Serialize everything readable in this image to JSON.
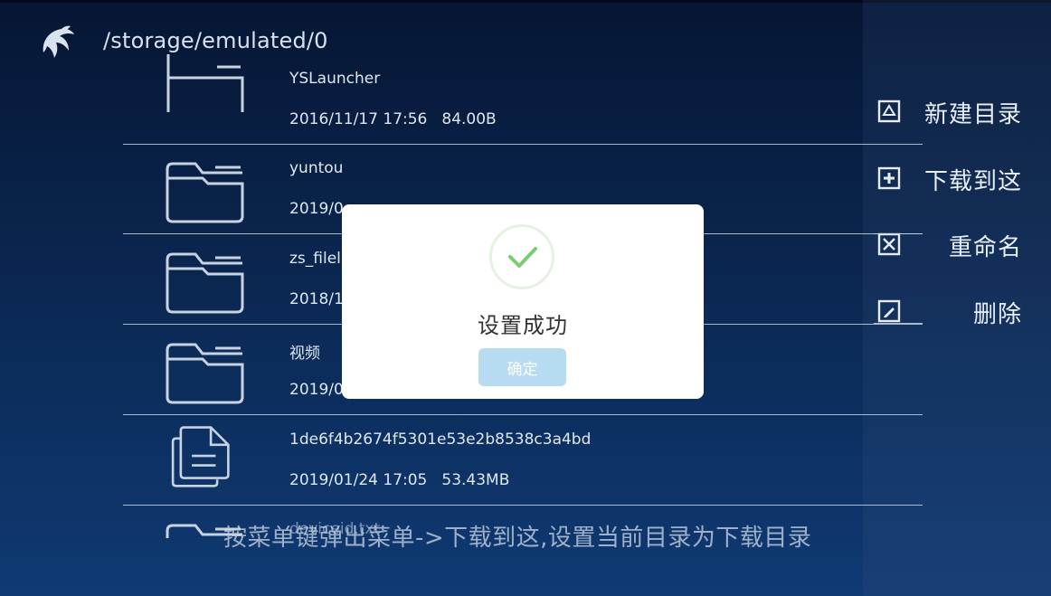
{
  "header": {
    "path": "/storage/emulated/0",
    "logo_icon": "dolphin-logo-icon"
  },
  "files": [
    {
      "type": "folder",
      "icon": "folder-icon",
      "name": "YSLauncher",
      "date": "2016/11/17 17:56",
      "size": "84.00B"
    },
    {
      "type": "folder",
      "icon": "folder-icon",
      "name": "yuntou",
      "date": "2019/0",
      "size": ""
    },
    {
      "type": "folder",
      "icon": "folder-icon",
      "name": "zs_filel",
      "date": "2018/1",
      "size": ""
    },
    {
      "type": "folder",
      "icon": "folder-icon",
      "name": "视频",
      "date": "2019/0",
      "size": ""
    },
    {
      "type": "file",
      "icon": "file-copy-icon",
      "name": "1de6f4b2674f5301e53e2b8538c3a4bd",
      "date": "2019/01/24 17:05",
      "size": "53.43MB"
    },
    {
      "type": "folder",
      "icon": "folder-icon",
      "name": "deviceid.txt",
      "date": "",
      "size": ""
    }
  ],
  "menu": {
    "items": [
      {
        "icon": "new-folder-icon",
        "label": "新建目录"
      },
      {
        "icon": "plus-box-icon",
        "label": "下载到这"
      },
      {
        "icon": "rename-box-icon",
        "label": "重命名"
      },
      {
        "icon": "edit-box-icon",
        "label": "删除"
      }
    ]
  },
  "hint": "按菜单键弹出菜单->下载到这,设置当前目录为下载目录",
  "dialog": {
    "icon": "check-icon",
    "title": "设置成功",
    "ok_label": "确定"
  },
  "colors": {
    "accent_success": "#7ccc74",
    "button_bg": "#b7dbf1",
    "background_top": "#061634",
    "background_bottom": "#0f3a74"
  }
}
